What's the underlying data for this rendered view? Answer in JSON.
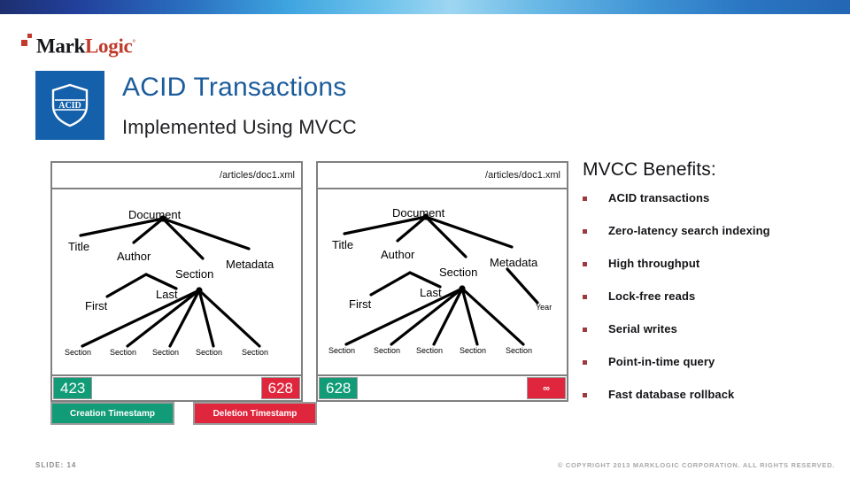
{
  "brand": {
    "logo_mark": "Mark",
    "logo_logic": "Logic",
    "logo_tm": "°",
    "icon_caption": "ACID",
    "accent_blue": "#1560ab",
    "accent_red": "#c0392b"
  },
  "header": {
    "title": "ACID Transactions",
    "subtitle": "Implemented Using MVCC",
    "title_color": "#1c5c9c"
  },
  "documents": [
    {
      "path": "/articles/doc1.xml",
      "creation_timestamp": "423",
      "deletion_timestamp": "628",
      "tree": {
        "root": "Document",
        "level1": [
          "Title",
          "Author",
          "Section",
          "Metadata"
        ],
        "author_children": [
          "First",
          "Last"
        ],
        "section_children": [
          "Section",
          "Section",
          "Section",
          "Section",
          "Section"
        ],
        "metadata_children": []
      }
    },
    {
      "path": "/articles/doc1.xml",
      "creation_timestamp": "628",
      "deletion_timestamp": "∞",
      "tree": {
        "root": "Document",
        "level1": [
          "Title",
          "Author",
          "Section",
          "Metadata"
        ],
        "author_children": [
          "First",
          "Last"
        ],
        "section_children": [
          "Section",
          "Section",
          "Section",
          "Section",
          "Section"
        ],
        "metadata_children": [
          "Year"
        ]
      }
    }
  ],
  "benefits": {
    "title": "MVCC Benefits:",
    "bullet_color": "#9e3a3d",
    "items": [
      "ACID transactions",
      "Zero-latency search indexing",
      "High throughput",
      "Lock-free reads",
      "Serial writes",
      "Point-in-time query",
      "Fast database rollback"
    ]
  },
  "legend": {
    "creation_label": "Creation Timestamp",
    "deletion_label": "Deletion Timestamp",
    "creation_color": "#119c77",
    "deletion_color": "#e0263c"
  },
  "footer": {
    "slide_number": "SLIDE: 14",
    "copyright": "© COPYRIGHT 2013 MARKLOGIC CORPORATION. ALL RIGHTS RESERVED."
  }
}
